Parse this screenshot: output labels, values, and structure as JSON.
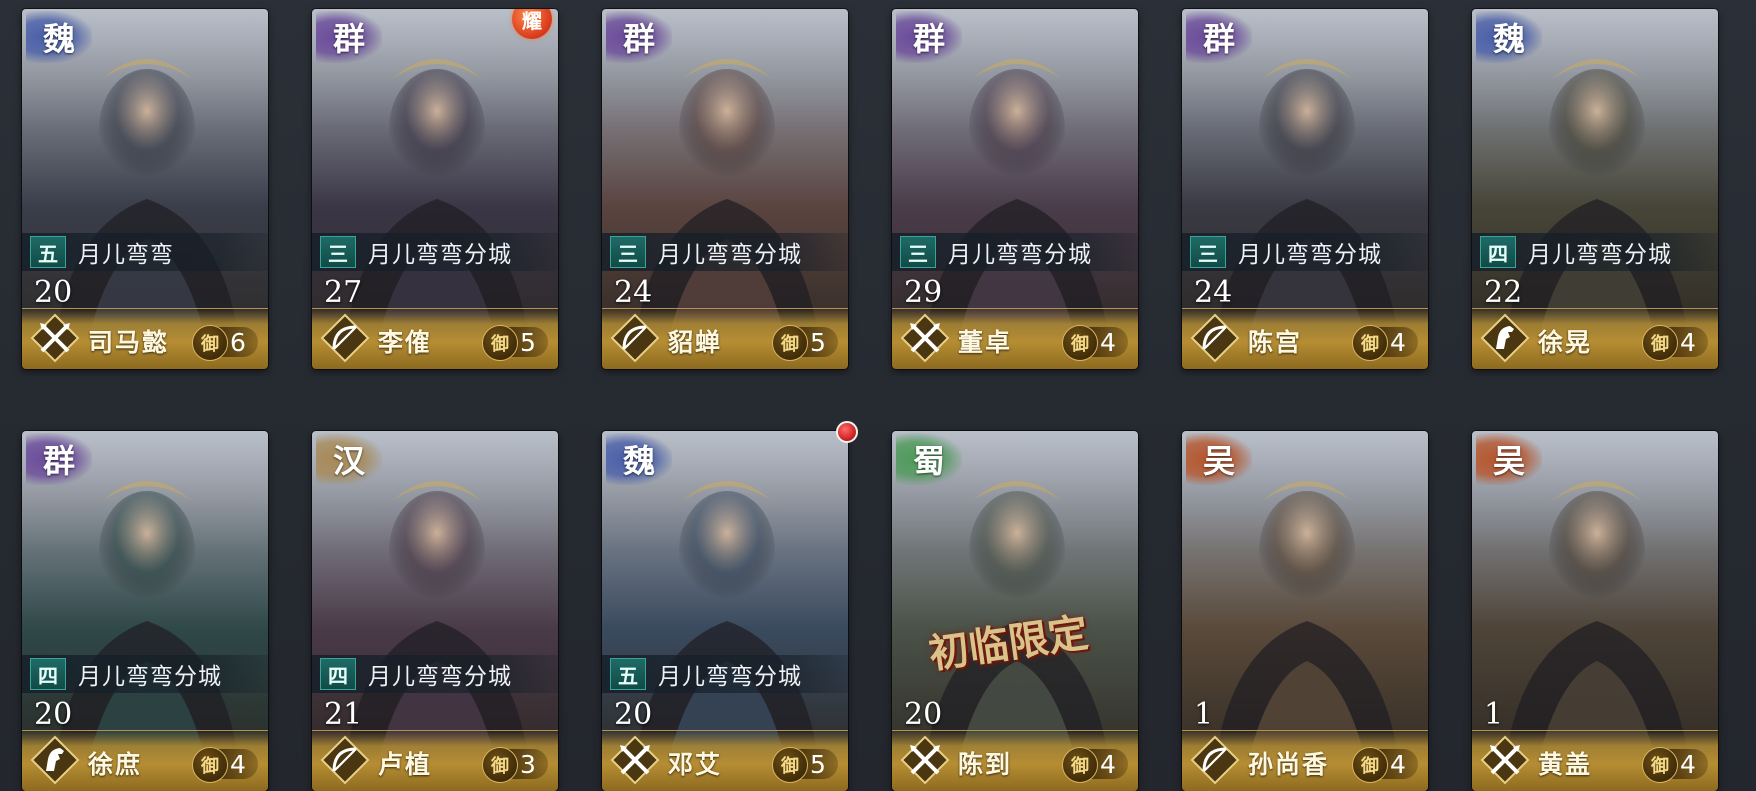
{
  "colors": {
    "wei": "#4a5fa8",
    "qun": "#6b4b9a",
    "han": "#a88a58",
    "shu": "#4f9a5a",
    "wu": "#b6572e"
  },
  "cards": [
    {
      "faction": "魏",
      "faction_color": "wei",
      "rank": "五",
      "owner": "月儿弯弯",
      "level": "20",
      "name": "司马懿",
      "troop_icon": "crossed-spears-icon",
      "defense_label": "御",
      "cost": "6",
      "tone": "#3a3e4a"
    },
    {
      "faction": "群",
      "faction_color": "qun",
      "rank": "三",
      "owner": "月儿弯弯分城",
      "level": "27",
      "name": "李傕",
      "troop_icon": "bow-icon",
      "defense_label": "御",
      "cost": "5",
      "tone": "#3b3646",
      "badge": "耀"
    },
    {
      "faction": "群",
      "faction_color": "qun",
      "rank": "三",
      "owner": "月儿弯弯分城",
      "level": "24",
      "name": "貂蝉",
      "troop_icon": "bow-icon",
      "defense_label": "御",
      "cost": "5",
      "tone": "#5a4440"
    },
    {
      "faction": "群",
      "faction_color": "qun",
      "rank": "三",
      "owner": "月儿弯弯分城",
      "level": "29",
      "name": "董卓",
      "troop_icon": "crossed-spears-icon",
      "defense_label": "御",
      "cost": "4",
      "tone": "#4a3c4a"
    },
    {
      "faction": "群",
      "faction_color": "qun",
      "rank": "三",
      "owner": "月儿弯弯分城",
      "level": "24",
      "name": "陈宫",
      "troop_icon": "bow-icon",
      "defense_label": "御",
      "cost": "4",
      "tone": "#3a3a44"
    },
    {
      "faction": "魏",
      "faction_color": "wei",
      "rank": "四",
      "owner": "月儿弯弯分城",
      "level": "22",
      "name": "徐晃",
      "troop_icon": "horse-icon",
      "defense_label": "御",
      "cost": "4",
      "tone": "#474538"
    },
    {
      "faction": "群",
      "faction_color": "qun",
      "rank": "四",
      "owner": "月儿弯弯分城",
      "level": "20",
      "name": "徐庶",
      "troop_icon": "horse-icon",
      "defense_label": "御",
      "cost": "4",
      "tone": "#2f4848"
    },
    {
      "faction": "汉",
      "faction_color": "han",
      "rank": "四",
      "owner": "月儿弯弯分城",
      "level": "21",
      "name": "卢植",
      "troop_icon": "bow-icon",
      "defense_label": "御",
      "cost": "3",
      "tone": "#4a3a48"
    },
    {
      "faction": "魏",
      "faction_color": "wei",
      "rank": "五",
      "owner": "月儿弯弯分城",
      "level": "20",
      "name": "邓艾",
      "troop_icon": "crossed-spears-icon",
      "defense_label": "御",
      "cost": "5",
      "tone": "#3a4a5e"
    },
    {
      "faction": "蜀",
      "faction_color": "shu",
      "rank": "",
      "owner": "",
      "level": "20",
      "name": "陈到",
      "troop_icon": "crossed-spears-icon",
      "defense_label": "御",
      "cost": "4",
      "tone": "#4b5248",
      "stamp": "初临限定"
    },
    {
      "faction": "吴",
      "faction_color": "wu",
      "rank": "",
      "owner": "",
      "level": "1",
      "name": "孙尚香",
      "troop_icon": "bow-icon",
      "defense_label": "御",
      "cost": "4",
      "tone": "#5a4a3a"
    },
    {
      "faction": "吴",
      "faction_color": "wu",
      "rank": "",
      "owner": "",
      "level": "1",
      "name": "黄盖",
      "troop_icon": "crossed-spears-icon",
      "defense_label": "御",
      "cost": "4",
      "tone": "#4e4438"
    }
  ]
}
